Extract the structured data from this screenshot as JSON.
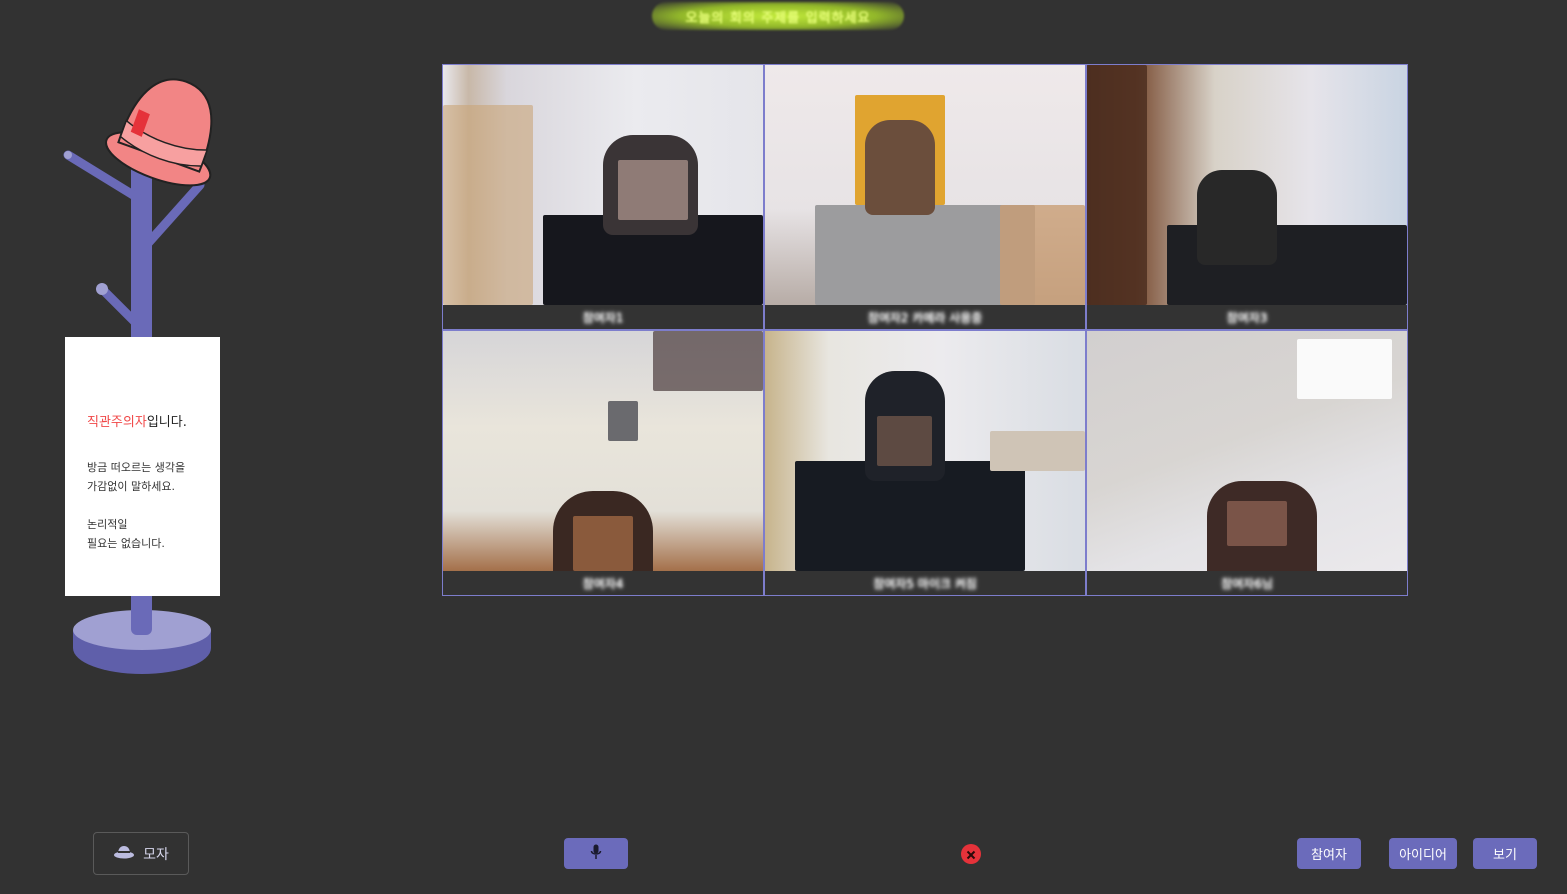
{
  "room": {
    "title": "오늘의 회의 주제를 입력하세요"
  },
  "hat_stand": {
    "sign": {
      "title_highlight": "직관주의자",
      "title_rest": "입니다.",
      "lines": [
        "방금 떠오르는 생각을",
        "가감없이 말하세요.",
        "",
        "논리적일",
        "필요는 없습니다."
      ]
    },
    "hat_color": "#f28585",
    "stand_color": "#6a6ab8"
  },
  "participants": [
    {
      "name": "참여자1",
      "status": "video"
    },
    {
      "name": "참여자2 카메라 사용중",
      "status": "video"
    },
    {
      "name": "참여자3",
      "status": "video"
    },
    {
      "name": "참여자4",
      "status": "video"
    },
    {
      "name": "참여자5 마이크 켜짐",
      "status": "video"
    },
    {
      "name": "참여자6님",
      "status": "video"
    }
  ],
  "controls": {
    "hat_label": "모자",
    "hat_icon": "hat-icon",
    "mic_icon": "microphone-icon",
    "leave_icon": "close-circle-icon",
    "participants_label": "참여자",
    "ideas_label": "아이디어",
    "view_label": "보기"
  },
  "colors": {
    "background": "#323232",
    "accent": "#6b6bbb",
    "tile_border": "#7d7dcc",
    "danger": "#e5323a"
  }
}
